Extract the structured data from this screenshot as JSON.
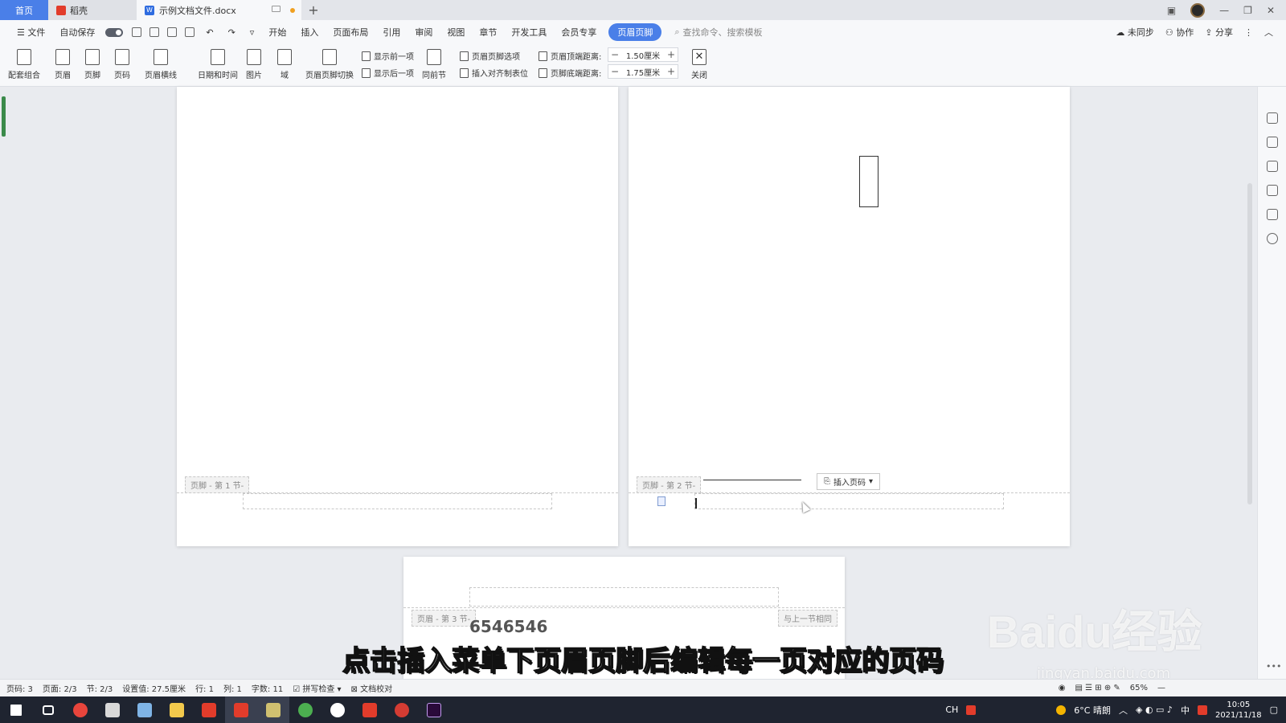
{
  "titlebar": {
    "tab_home": "首页",
    "tab_daoke": "稻壳",
    "tab_doc": "示例文档文件.docx",
    "add_tab": "+"
  },
  "menubar": {
    "file": "文件",
    "autosave": "自动保存",
    "items": [
      "开始",
      "插入",
      "页面布局",
      "引用",
      "审阅",
      "视图",
      "章节",
      "开发工具",
      "会员专享"
    ],
    "active": "页眉页脚",
    "search_placeholder": "查找命令、搜索模板",
    "sync": "未同步",
    "collab": "协作",
    "share": "分享"
  },
  "ribbon": {
    "combo": "配套组合",
    "header": "页眉",
    "footer": "页脚",
    "page_num": "页码",
    "header_line": "页眉横线",
    "datetime": "日期和时间",
    "picture": "图片",
    "field": "域",
    "switch": "页眉页脚切换",
    "show_prev": "显示前一项",
    "show_next": "显示后一项",
    "same_prev": "同前节",
    "hf_options": "页眉页脚选项",
    "insert_tab": "插入对齐制表位",
    "header_top_label": "页眉顶端距离:",
    "header_top_value": "1.50厘米",
    "footer_bottom_label": "页脚底端距离:",
    "footer_bottom_value": "1.75厘米",
    "close": "关闭"
  },
  "document": {
    "page1_footer_tag": "页脚 - 第 1 节-",
    "page2_footer_tag": "页脚 - 第 2 节-",
    "insert_page_num": "插入页码",
    "page3_header_tag": "页眉 - 第 3 节-",
    "page3_same_prev": "与上一节相同",
    "page3_text": "6546546"
  },
  "subtitle": "点击插入菜单下页眉页脚后编辑每一页对应的页码",
  "watermark": "Baidu经验",
  "watermark_url": "jingyan.baidu.com",
  "statusbar": {
    "page": "页码: 3",
    "pages": "页面: 2/3",
    "section": "节: 2/3",
    "setting": "设置值: 27.5厘米",
    "row": "行: 1",
    "col": "列: 1",
    "words": "字数: 11",
    "spell": "拼写检查",
    "proof": "文档校对",
    "zoom": "65%"
  },
  "taskbar": {
    "temp": "6°C 晴朗",
    "ime_lang": "CH",
    "ime_mode": "中",
    "time": "10:05",
    "date": "2021/11/18"
  },
  "colors": {
    "accent": "#4a7fe8",
    "taskbar": "#1f2430"
  }
}
